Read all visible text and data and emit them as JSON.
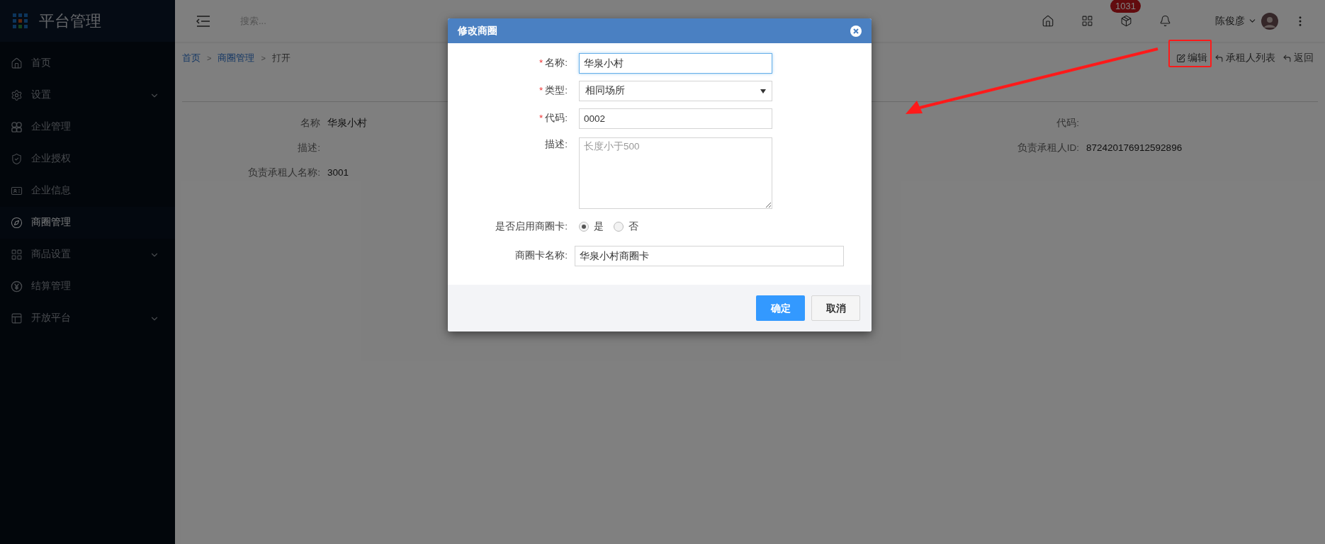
{
  "brand": {
    "title": "平台管理"
  },
  "sidebar": {
    "items": [
      {
        "label": "首页",
        "selected": false
      },
      {
        "label": "设置",
        "selected": false,
        "expanded": false
      },
      {
        "label": "企业管理",
        "selected": false
      },
      {
        "label": "企业授权",
        "selected": false
      },
      {
        "label": "企业信息",
        "selected": false
      },
      {
        "label": "商圈管理",
        "selected": true
      },
      {
        "label": "商品设置",
        "selected": false,
        "expanded": false
      },
      {
        "label": "结算管理",
        "selected": false
      },
      {
        "label": "开放平台",
        "selected": false,
        "expanded": false
      }
    ]
  },
  "header": {
    "search": {
      "placeholder": "搜索..."
    },
    "badge": "1031",
    "user": "陈俊彦"
  },
  "breadcrumb": [
    {
      "label": "首页",
      "link": true
    },
    {
      "separator": ">",
      "label": "商圈管理",
      "link": true
    },
    {
      "separator": ">",
      "label": "打开",
      "link": false
    }
  ],
  "actions": [
    {
      "label": "编辑"
    },
    {
      "label": "承租人列表"
    },
    {
      "label": "返回"
    }
  ],
  "details": {
    "left": [
      {
        "label": "名称",
        "value": "华泉小村"
      },
      {
        "label": "描述:"
      },
      {
        "label": "负责承租人名称:",
        "value": "3001"
      }
    ],
    "right": [
      {
        "label": "代码:"
      },
      {
        "label": "负责承租人ID:",
        "value": "872420176912592896"
      }
    ]
  },
  "dialog": {
    "title": "修改商圈",
    "fields": [
      {
        "kind": "text",
        "required_mark": "*",
        "label": "名称:",
        "value": "华泉小村",
        "focused": true
      },
      {
        "kind": "select",
        "required_mark": "*",
        "label": "类型:",
        "value": "相同场所"
      },
      {
        "kind": "text",
        "required_mark": "*",
        "label": "代码:",
        "value": "0002",
        "focused": false
      },
      {
        "kind": "textarea",
        "label": "描述:",
        "placeholder": "长度小于500"
      },
      {
        "kind": "radio",
        "label": "是否启用商圈卡:",
        "options": [
          {
            "label": "是",
            "selected": true
          },
          {
            "label": "否",
            "selected": false
          }
        ]
      },
      {
        "kind": "wide",
        "label": "商圈卡名称:",
        "value": "华泉小村商圈卡",
        "focused": false
      }
    ],
    "buttons": [
      {
        "label": "确定",
        "kind": "primary"
      },
      {
        "label": "取消",
        "kind": "default"
      }
    ]
  }
}
